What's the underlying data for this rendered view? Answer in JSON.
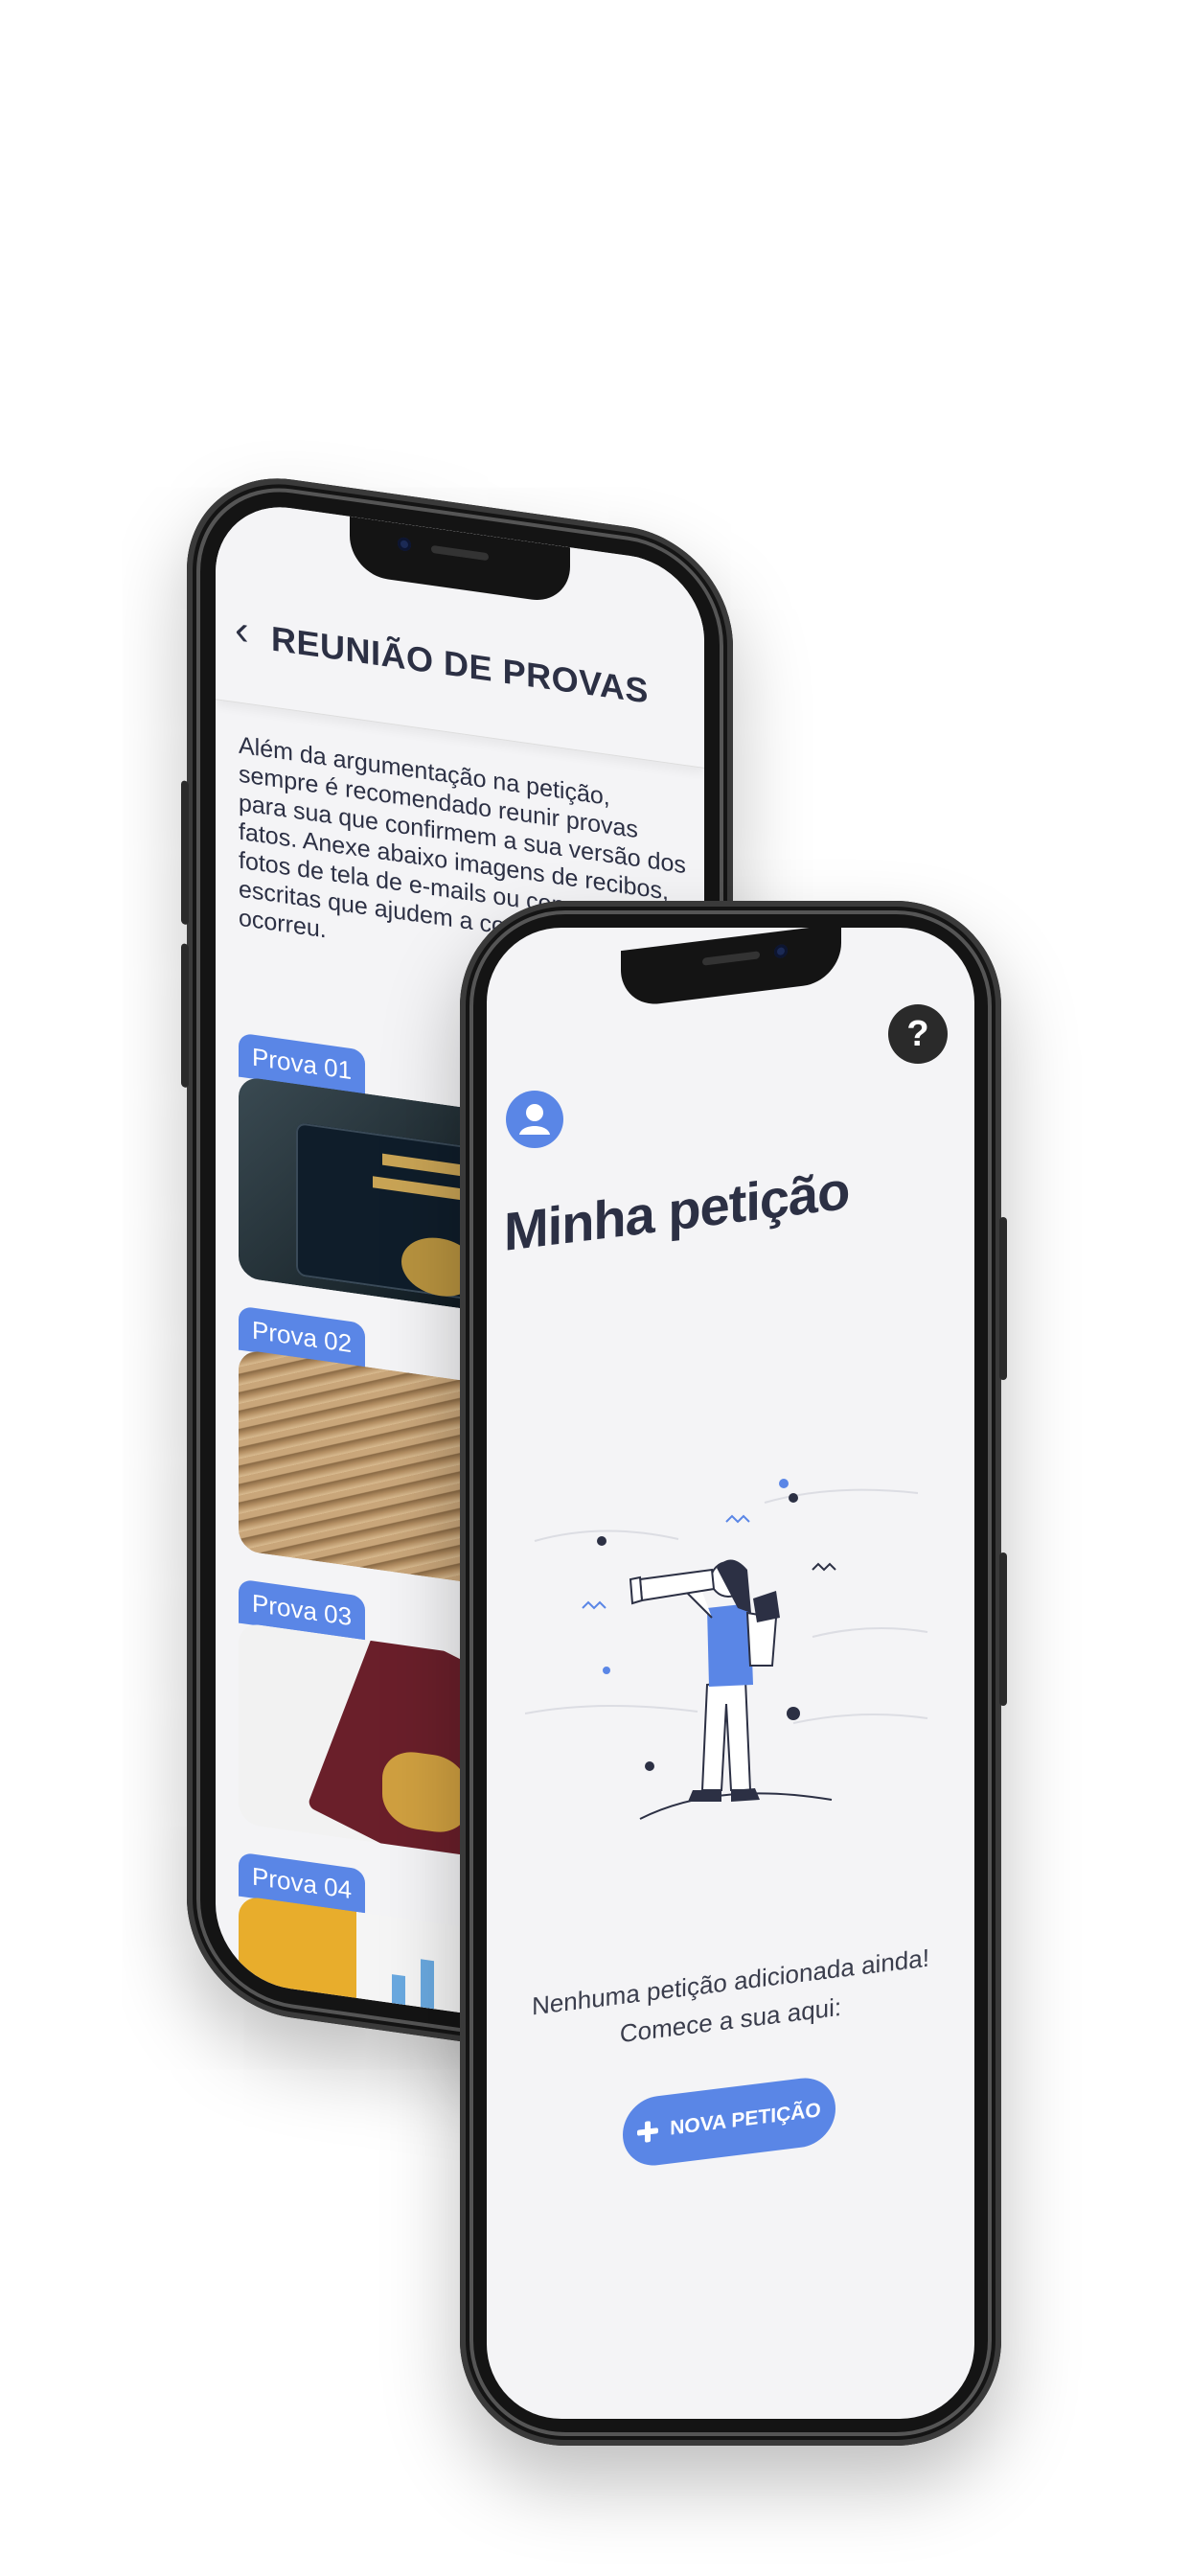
{
  "back_screen": {
    "title": "REUNIÃO DE PROVAS",
    "back_icon": "chevron-left-icon",
    "description": "Além da argumentação na petição, sempre é recomendado reunir provas para sua que confirmem a sua versão dos fatos. Anexe abaixo imagens de recibos, fotos de tela de e-mails ou conversas escritas que ajudem a comprovar o que ocorreu.",
    "proofs": [
      {
        "label": "Prova 01"
      },
      {
        "label": "Prova 02"
      },
      {
        "label": "Prova 03"
      },
      {
        "label": "Prova 04"
      }
    ]
  },
  "front_screen": {
    "help_label": "?",
    "title": "Minha petição",
    "empty_line1": "Nenhuma petição adicionada ainda!",
    "empty_line2": "Comece a sua aqui:",
    "new_button_icon": "plus-icon",
    "new_button_label": "NOVA PETIÇÃO"
  },
  "colors": {
    "accent": "#5a86e6",
    "text_dark": "#2c3044",
    "screen_bg": "#f4f4f6",
    "phone_body": "#141414"
  }
}
